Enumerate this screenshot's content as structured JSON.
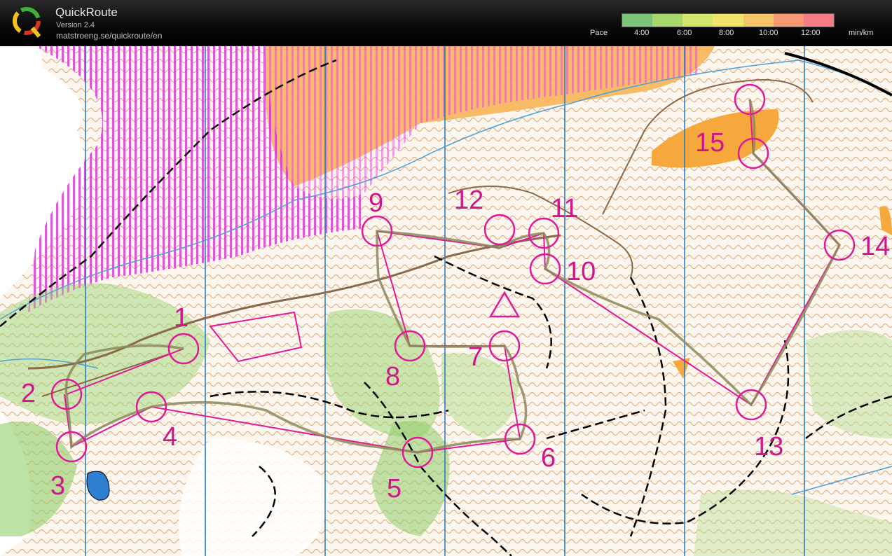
{
  "header": {
    "app_title": "QuickRoute",
    "version": "Version 2.4",
    "url": "matstroeng.se/quickroute/en",
    "logo_letter": "Q"
  },
  "pace_legend": {
    "label": "Pace",
    "ticks": [
      "4:00",
      "6:00",
      "8:00",
      "10:00",
      "12:00"
    ],
    "unit": "min/km",
    "colors": [
      "#7ec47a",
      "#a6d86e",
      "#d4e56c",
      "#f1e46a",
      "#f7c46a",
      "#f79a74",
      "#f47c86"
    ]
  },
  "map": {
    "control_numbers": [
      "1",
      "2",
      "3",
      "4",
      "5",
      "6",
      "7",
      "8",
      "9",
      "10",
      "11",
      "12",
      "13",
      "14",
      "15"
    ],
    "colors": {
      "course": "#e0189a",
      "route": "#8a8a5a",
      "contour": "#b5651d",
      "vegetation": "#9ed678",
      "open_land": "#f7b65a",
      "water": "#4aa0d8",
      "magnetic_north": "#1a78c8"
    }
  }
}
